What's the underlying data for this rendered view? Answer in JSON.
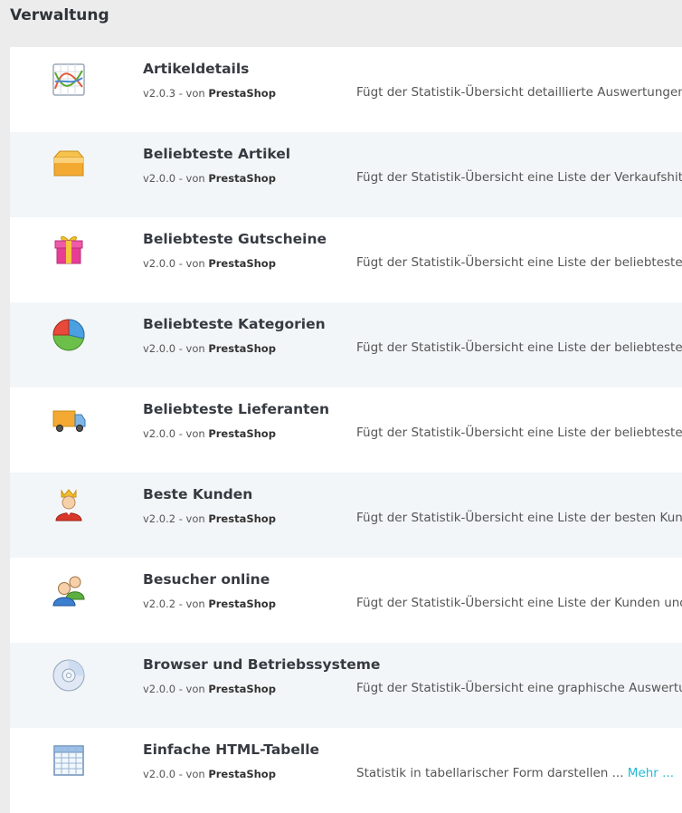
{
  "section": {
    "title": "Verwaltung"
  },
  "meta_text": {
    "von": "- von"
  },
  "modules": [
    {
      "name": "Artikeldetails",
      "version": "v2.0.3",
      "author": "PrestaShop",
      "description": "Fügt der Statistik-Übersicht detaillierte Auswertungen für",
      "icon": "line-chart-icon"
    },
    {
      "name": "Beliebteste Artikel",
      "version": "v2.0.0",
      "author": "PrestaShop",
      "description": "Fügt der Statistik-Übersicht eine Liste der Verkaufshits h",
      "icon": "box-icon"
    },
    {
      "name": "Beliebteste Gutscheine",
      "version": "v2.0.0",
      "author": "PrestaShop",
      "description": "Fügt der Statistik-Übersicht eine Liste der beliebtesten G",
      "icon": "gift-icon"
    },
    {
      "name": "Beliebteste Kategorien",
      "version": "v2.0.0",
      "author": "PrestaShop",
      "description": "Fügt der Statistik-Übersicht eine Liste der beliebtesten K",
      "icon": "pie-chart-icon"
    },
    {
      "name": "Beliebteste Lieferanten",
      "version": "v2.0.0",
      "author": "PrestaShop",
      "description": "Fügt der Statistik-Übersicht eine Liste der beliebtesten L",
      "icon": "truck-icon"
    },
    {
      "name": "Beste Kunden",
      "version": "v2.0.2",
      "author": "PrestaShop",
      "description": "Fügt der Statistik-Übersicht eine Liste der besten Kunde",
      "icon": "king-icon"
    },
    {
      "name": "Besucher online",
      "version": "v2.0.2",
      "author": "PrestaShop",
      "description": "Fügt der Statistik-Übersicht eine Liste der Kunden und B",
      "icon": "users-icon"
    },
    {
      "name": "Browser und Betriebssysteme",
      "version": "v2.0.0",
      "author": "PrestaShop",
      "description": "Fügt der Statistik-Übersicht eine graphische Auswertung",
      "icon": "cd-icon"
    },
    {
      "name": "Einfache HTML-Tabelle",
      "version": "v2.0.0",
      "author": "PrestaShop",
      "description": "Statistik in tabellarischer Form darstellen ...",
      "more": "Mehr ...",
      "icon": "table-icon"
    }
  ],
  "colors": {
    "accent": "#25b9d7",
    "row_alt": "#f3f6f8",
    "page_bg": "#ececec"
  }
}
